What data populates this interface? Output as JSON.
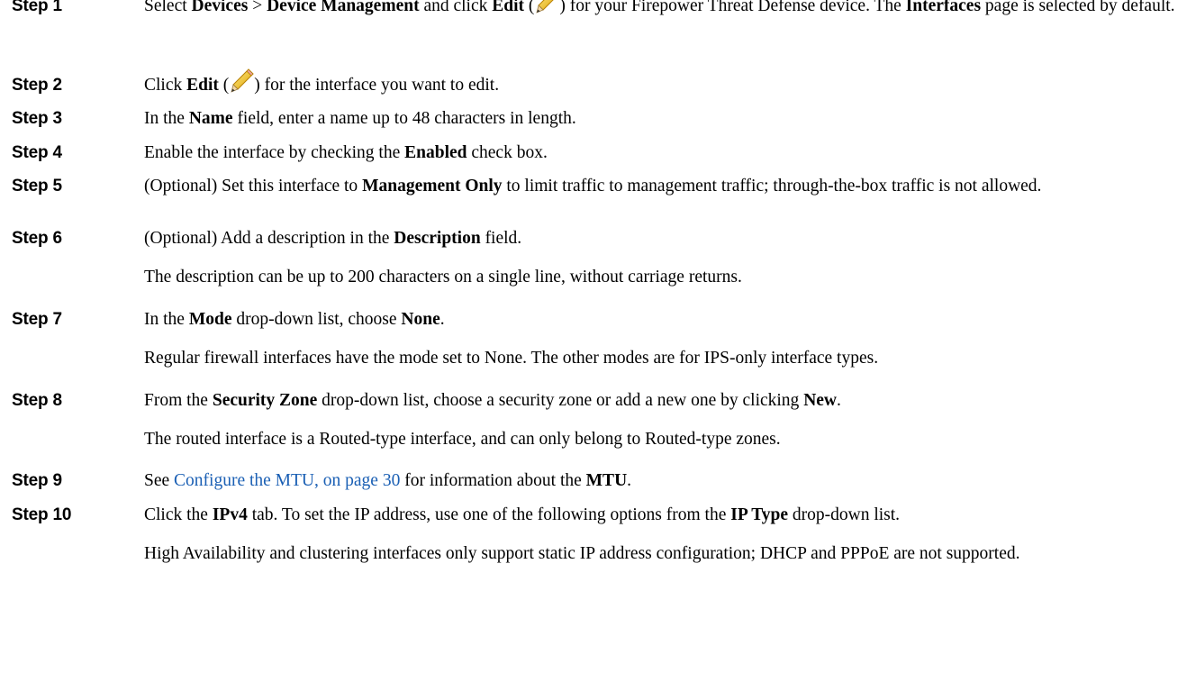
{
  "steps": [
    {
      "label": "Step 1",
      "paragraphs": [
        [
          {
            "t": "Select "
          },
          {
            "t": "Devices",
            "b": true
          },
          {
            "t": " > "
          },
          {
            "t": "Device Management",
            "b": true
          },
          {
            "t": " and click "
          },
          {
            "t": "Edit",
            "b": true
          },
          {
            "t": " ("
          },
          {
            "icon": "pencil-edit-icon"
          },
          {
            "t": ") for your Firepower Threat Defense device. The "
          },
          {
            "t": "Interfaces",
            "b": true
          },
          {
            "t": " page is selected by default."
          }
        ]
      ]
    },
    {
      "label": "Step 2",
      "paragraphs": [
        [
          {
            "t": "Click "
          },
          {
            "t": "Edit",
            "b": true
          },
          {
            "t": " ("
          },
          {
            "icon": "pencil-edit-icon"
          },
          {
            "t": ") for the interface you want to edit."
          }
        ]
      ]
    },
    {
      "label": "Step 3",
      "paragraphs": [
        [
          {
            "t": "In the "
          },
          {
            "t": "Name",
            "b": true
          },
          {
            "t": " field, enter a name up to 48 characters in length."
          }
        ]
      ]
    },
    {
      "label": "Step 4",
      "paragraphs": [
        [
          {
            "t": "Enable the interface by checking the "
          },
          {
            "t": "Enabled",
            "b": true
          },
          {
            "t": " check box."
          }
        ]
      ]
    },
    {
      "label": "Step 5",
      "paragraphs": [
        [
          {
            "t": "(Optional) Set this interface to "
          },
          {
            "t": "Management Only",
            "b": true
          },
          {
            "t": " to limit traffic to management traffic; through-the-box traffic is not allowed."
          }
        ]
      ]
    },
    {
      "label": "Step 6",
      "paragraphs": [
        [
          {
            "t": "(Optional) Add a description in the "
          },
          {
            "t": "Description",
            "b": true
          },
          {
            "t": " field."
          }
        ],
        [
          {
            "t": "The description can be up to 200 characters on a single line, without carriage returns."
          }
        ]
      ]
    },
    {
      "label": "Step 7",
      "paragraphs": [
        [
          {
            "t": "In the "
          },
          {
            "t": "Mode",
            "b": true
          },
          {
            "t": " drop-down list, choose "
          },
          {
            "t": "None",
            "b": true
          },
          {
            "t": "."
          }
        ],
        [
          {
            "t": "Regular firewall interfaces have the mode set to None. The other modes are for IPS-only interface types."
          }
        ]
      ]
    },
    {
      "label": "Step 8",
      "paragraphs": [
        [
          {
            "t": "From the "
          },
          {
            "t": "Security Zone",
            "b": true
          },
          {
            "t": " drop-down list, choose a security zone or add a new one by clicking "
          },
          {
            "t": "New",
            "b": true
          },
          {
            "t": "."
          }
        ],
        [
          {
            "t": "The routed interface is a Routed-type interface, and can only belong to Routed-type zones."
          }
        ]
      ]
    },
    {
      "label": "Step 9",
      "paragraphs": [
        [
          {
            "t": "See "
          },
          {
            "t": "Configure the MTU, on page 30",
            "link": true
          },
          {
            "t": " for information about the "
          },
          {
            "t": "MTU",
            "b": true
          },
          {
            "t": "."
          }
        ]
      ]
    },
    {
      "label": "Step 10",
      "paragraphs": [
        [
          {
            "t": "Click the "
          },
          {
            "t": "IPv4",
            "b": true
          },
          {
            "t": " tab. To set the IP address, use one of the following options from the "
          },
          {
            "t": "IP Type",
            "b": true
          },
          {
            "t": " drop-down list."
          }
        ],
        [
          {
            "t": "High Availability and clustering interfaces only support static IP address configuration; DHCP and PPPoE are not supported."
          }
        ]
      ]
    }
  ]
}
